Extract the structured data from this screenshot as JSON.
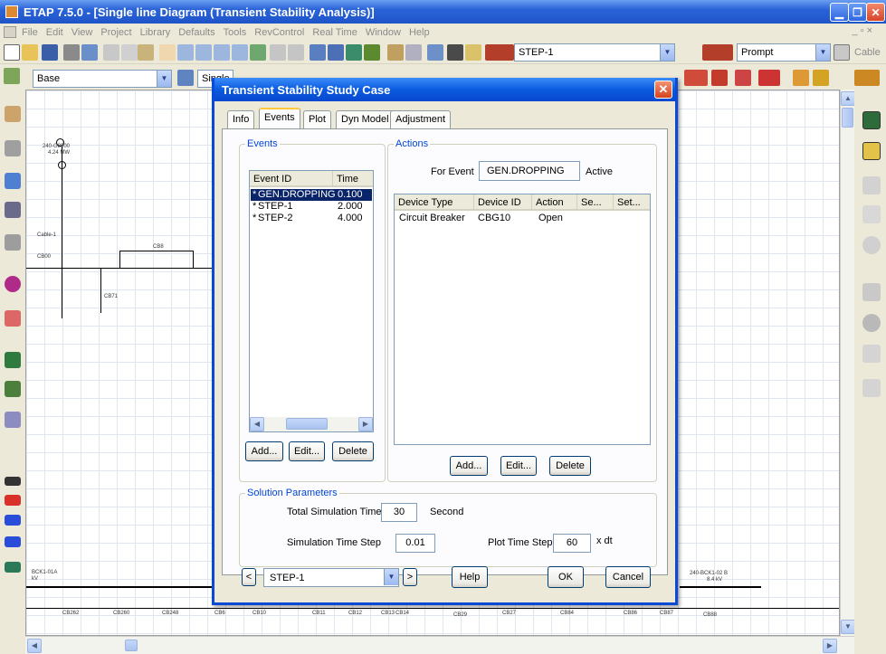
{
  "app": {
    "title": "ETAP 7.5.0 - [Single line Diagram (Transient Stability Analysis)]",
    "menu": [
      "File",
      "Edit",
      "View",
      "Project",
      "Library",
      "Defaults",
      "Tools",
      "RevControl",
      "Real Time",
      "Window",
      "Help"
    ]
  },
  "toolbar": {
    "config_combo": "STEP-1",
    "prompt_combo": "Prompt",
    "base_combo": "Base",
    "single_line_combo": "Single line",
    "cable_label": "Cable"
  },
  "diagram": {
    "labels": [
      "240-G8000",
      "4.24 MW",
      "Cable-1",
      "CB00",
      "CB8",
      "CB71",
      "BCK1-01A",
      "kV",
      "240-BCK1-02 B",
      "8.4 kV",
      "CB262",
      "CB260",
      "CB248",
      "CB6",
      "CB10",
      "CB11",
      "CB12",
      "CB13",
      "CB14",
      "CB29",
      "CB27",
      "CB84",
      "CB86",
      "CB87",
      "CB88"
    ]
  },
  "dialog": {
    "title": "Transient Stability Study Case",
    "tabs": [
      "Info",
      "Events",
      "Plot",
      "Dyn Model",
      "Adjustment"
    ],
    "active_tab": "Events",
    "events_group": "Events",
    "events_columns": [
      "Event ID",
      "Time"
    ],
    "events": [
      {
        "marker": "*",
        "id": "GEN.DROPPING",
        "time": "0.100",
        "selected": true
      },
      {
        "marker": "*",
        "id": "STEP-1",
        "time": "2.000",
        "selected": false
      },
      {
        "marker": "*",
        "id": "STEP-2",
        "time": "4.000",
        "selected": false
      }
    ],
    "events_buttons": {
      "add": "Add...",
      "edit": "Edit...",
      "delete": "Delete"
    },
    "actions_group": "Actions",
    "for_event_label": "For Event",
    "for_event_value": "GEN.DROPPING",
    "active_label": "Active",
    "actions_columns": [
      "Device Type",
      "Device ID",
      "Action",
      "Se...",
      "Set..."
    ],
    "actions": [
      {
        "device_type": "Circuit Breaker",
        "device_id": "CBG10",
        "action": "Open"
      }
    ],
    "actions_buttons": {
      "add": "Add...",
      "edit": "Edit...",
      "delete": "Delete"
    },
    "solution": {
      "group": "Solution Parameters",
      "total_time_label": "Total Simulation Time",
      "total_time_value": "30",
      "total_time_unit": "Second",
      "step_label": "Simulation Time Step",
      "step_value": "0.01",
      "plot_step_label": "Plot Time Step",
      "plot_step_value": "60",
      "plot_step_unit": "x dt"
    },
    "bottom": {
      "case_combo": "STEP-1",
      "help": "Help",
      "ok": "OK",
      "cancel": "Cancel"
    }
  }
}
